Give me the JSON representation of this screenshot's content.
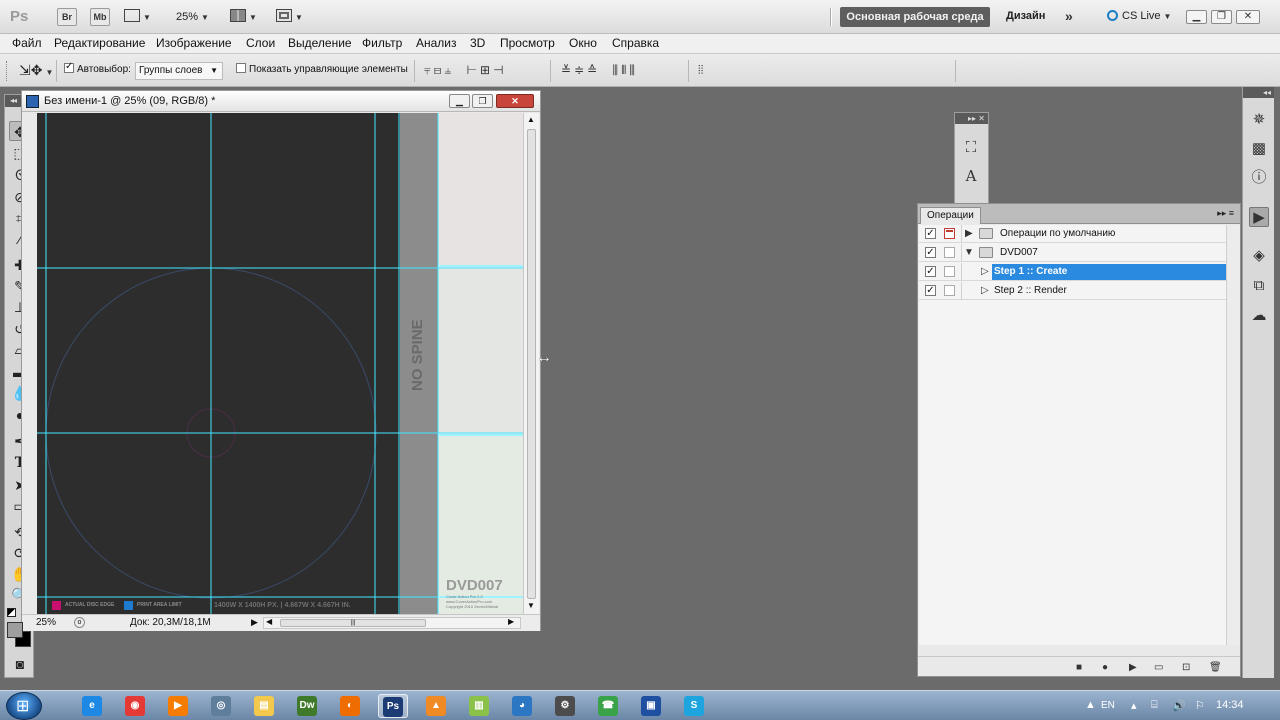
{
  "app": {
    "logo": "Ps",
    "bridge_label": "Br",
    "minibridge_label": "Mb",
    "zoom": "25%",
    "workspace": "Основная рабочая среда",
    "workspace_alt": "Дизайн",
    "more_glyph": "»",
    "cs_live": "CS Live",
    "window_minimize": "▁",
    "window_restore": "❐",
    "window_close": "✕"
  },
  "menu": [
    "Файл",
    "Редактирование",
    "Изображение",
    "Слои",
    "Выделение",
    "Фильтр",
    "Анализ",
    "3D",
    "Просмотр",
    "Окно",
    "Справка"
  ],
  "options": {
    "autoselect_label": "Автовыбор:",
    "autoselect_checked": true,
    "layer_select_value": "Группы слоев",
    "show_transform_label": "Показать управляющие элементы",
    "show_transform_checked": false
  },
  "document": {
    "title": "Без имени-1 @ 25% (09, RGB/8) *",
    "status_zoom": "25%",
    "status_doc": "Док: 20,3M/18,1M",
    "scroll_grip": "|||",
    "spine_text": "NO SPINE",
    "template_title": "DVD007",
    "template_note_1": "Cover Action Pro 2.0",
    "template_note_2": "www.CoverActionPro.com",
    "template_note_3": "Copyright 2010 Zevrix/Mistral",
    "legend_disc_edge": "ACTUAL DISC EDGE",
    "legend_print_area": "PRINT AREA LIMIT",
    "dimensions_note": "1400W X 1400H PX. | 4.667W X 4.667H IN."
  },
  "actions_panel": {
    "tab": "Операции",
    "menu_glyph": "▸▸ ≡",
    "rows": [
      {
        "label": "Операции по умолчанию",
        "type": "set",
        "expanded": false,
        "checked": true,
        "dialog_on": true
      },
      {
        "label": "DVD007",
        "type": "set",
        "expanded": true,
        "checked": true,
        "dialog_on": false
      },
      {
        "label": "Step 1 :: Create",
        "type": "action",
        "expanded": false,
        "checked": true,
        "selected": true
      },
      {
        "label": "Step 2 :: Render",
        "type": "action",
        "expanded": false,
        "checked": true,
        "selected": false
      }
    ]
  },
  "taskbar": {
    "lang": "EN",
    "time": "14:34",
    "apps": [
      {
        "name": "ie",
        "label": "e",
        "color": "#1e88e5"
      },
      {
        "name": "chrome",
        "label": "◉",
        "color": "#e53935"
      },
      {
        "name": "media",
        "label": "▶",
        "color": "#f57c00"
      },
      {
        "name": "maps",
        "label": "◎",
        "color": "#5f7e9c"
      },
      {
        "name": "explorer",
        "label": "▤",
        "color": "#f2c94c"
      },
      {
        "name": "dreamweaver",
        "label": "Dw",
        "color": "#3f7a2a"
      },
      {
        "name": "firefox",
        "label": "◐",
        "color": "#ef6c00"
      },
      {
        "name": "photoshop",
        "label": "Ps",
        "color": "#1c3a73"
      },
      {
        "name": "app-orange",
        "label": "▲",
        "color": "#f08a24"
      },
      {
        "name": "app-green",
        "label": "▥",
        "color": "#8ac249"
      },
      {
        "name": "browser",
        "label": "◕",
        "color": "#2c77c4"
      },
      {
        "name": "tools",
        "label": "⚙",
        "color": "#4c4c4c"
      },
      {
        "name": "messenger",
        "label": "☎",
        "color": "#3aa34a"
      },
      {
        "name": "save",
        "label": "▣",
        "color": "#1f4fa0"
      },
      {
        "name": "skype",
        "label": "S",
        "color": "#1ea5e0"
      }
    ]
  },
  "colors": {
    "accent": "#2a8ae0",
    "guide": "#41e6ff",
    "canvas_bg": "#2d2d2d",
    "spine": "#8c8c8c",
    "disc_edge": "#c9106f",
    "print_area": "#1e7bd0"
  }
}
